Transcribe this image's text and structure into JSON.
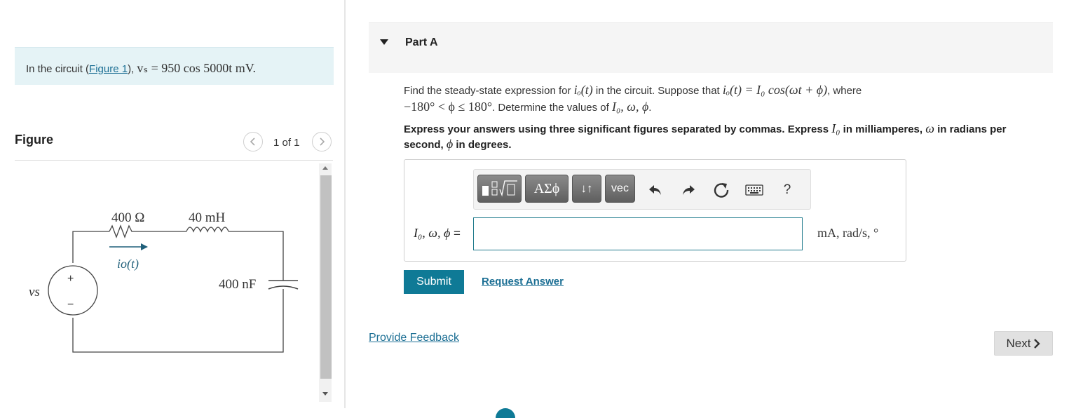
{
  "intro": {
    "prefix": "In the circuit (",
    "link": "Figure 1",
    "suffix": "), ",
    "math": "vₛ = 950 cos 5000t mV."
  },
  "figure": {
    "title": "Figure",
    "pager": "1 of 1",
    "prev_icon": "chevron-left-icon",
    "next_icon": "chevron-right-icon",
    "circuit": {
      "resistor": "400 Ω",
      "inductor": "40 mH",
      "capacitor": "400 nF",
      "current": "io(t)",
      "source": "vs",
      "plus": "+",
      "minus": "−"
    }
  },
  "part": {
    "title": "Part A"
  },
  "question": {
    "line1_a": "Find the steady-state expression for ",
    "line1_math_a": "iₒ(t)",
    "line1_b": " in the circuit. Suppose that ",
    "line1_math_b": "iₒ(t) = I₀ cos(ωt + ϕ)",
    "line1_c": ", where",
    "line2_math": "−180° < ϕ ≤ 180°",
    "line2_a": ". Determine the values of ",
    "line2_math_b": "I₀, ω, ϕ",
    "line2_b": "."
  },
  "instruction": {
    "a": "Express your answers using three significant figures separated by commas. Express ",
    "m1": "I₀",
    "b": " in milliamperes, ",
    "m2": "ω",
    "c": " in radians per second, ",
    "m3": "ϕ",
    "d": " in degrees."
  },
  "toolbar": {
    "templates_icon": "templates-icon",
    "greek": "ΑΣϕ",
    "arrows": "↓↑",
    "vec": "vec",
    "undo_icon": "undo-icon",
    "redo_icon": "redo-icon",
    "reset_icon": "reset-icon",
    "keyboard_icon": "keyboard-icon",
    "help": "?"
  },
  "answer": {
    "label_math": "I₀, ω, ϕ",
    "label_eq": " =",
    "value": "",
    "units": "mA, rad/s, °"
  },
  "actions": {
    "submit": "Submit",
    "request_answer": "Request Answer",
    "provide_feedback": "Provide Feedback",
    "next": "Next"
  },
  "colors": {
    "accent": "#0f7a96",
    "link": "#1c6f94",
    "intro_bg": "#e5f3f6"
  }
}
